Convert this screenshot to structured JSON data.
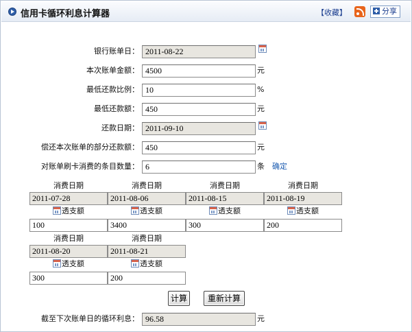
{
  "header": {
    "title": "信用卡循环利息计算器",
    "favorite": "【收藏】",
    "share": "分享"
  },
  "form": {
    "bill_date": {
      "label": "银行账单日：",
      "value": "2011-08-22"
    },
    "bill_amount": {
      "label": "本次账单金额：",
      "value": "4500",
      "unit": "元"
    },
    "min_ratio": {
      "label": "最低还款比例：",
      "value": "10",
      "unit": "%"
    },
    "min_payment": {
      "label": "最低还款额：",
      "value": "450",
      "unit": "元"
    },
    "repay_date": {
      "label": "还款日期：",
      "value": "2011-09-10"
    },
    "partial_payment": {
      "label": "偿还本次账单的部分还款额：",
      "value": "450",
      "unit": "元"
    },
    "item_count": {
      "label": "对账单刷卡消费的条目数量：",
      "value": "6",
      "unit": "条",
      "confirm": "确定"
    }
  },
  "entries": {
    "date_header": "消费日期",
    "overdraft_label": "透支额",
    "row1": [
      {
        "date": "2011-07-28",
        "amount": "100"
      },
      {
        "date": "2011-08-06",
        "amount": "3400"
      },
      {
        "date": "2011-08-15",
        "amount": "300"
      },
      {
        "date": "2011-08-19",
        "amount": "200"
      }
    ],
    "row2": [
      {
        "date": "2011-08-20",
        "amount": "300"
      },
      {
        "date": "2011-08-21",
        "amount": "200"
      }
    ]
  },
  "buttons": {
    "calculate": "计算",
    "recalculate": "重新计算"
  },
  "result": {
    "label": "截至下次账单日的循环利息：",
    "value": "96.58",
    "unit": "元"
  },
  "icons": {
    "header": "circle-arrow-icon",
    "rss": "rss-icon",
    "share": "plus-square-icon",
    "calendar": "calendar-icon"
  }
}
